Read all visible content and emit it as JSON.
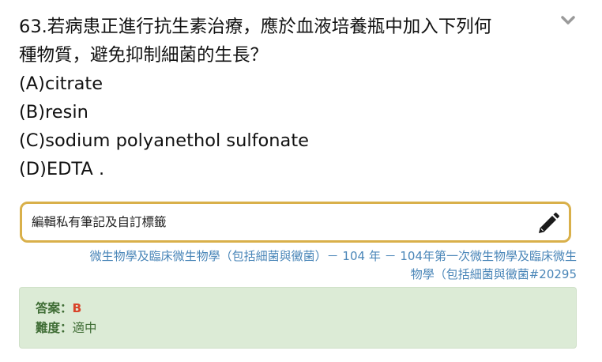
{
  "question": {
    "lines": [
      "63.若病患正進行抗生素治療，應於血液培養瓶中加入下列何",
      "種物質，避免抑制細菌的生長？",
      "(A)citrate",
      "(B)resin",
      "(C)sodium polyanethol sulfonate",
      "(D)EDTA ."
    ]
  },
  "collapse_icon": "chevron-down-icon",
  "note": {
    "placeholder": "編輯私有筆記及自訂標籤",
    "value": "",
    "edit_icon": "pencil-icon",
    "border_color": "#d9b04a"
  },
  "source": {
    "line1": "微生物學及臨床微生物學（包括細菌與黴菌）－ 104 年 － 104年第一次微生物學及臨床微生",
    "line2": "物學（包括細菌與黴菌#20295",
    "color": "#4a86b8"
  },
  "answer": {
    "answer_label": "答案：",
    "answer_value": "B",
    "difficulty_label": "難度：",
    "difficulty_value": "適中",
    "background": "#dcebd6"
  }
}
